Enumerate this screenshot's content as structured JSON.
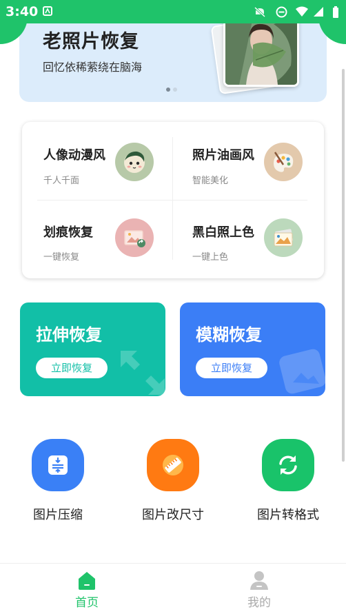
{
  "status_bar": {
    "time": "3:40"
  },
  "banner": {
    "title": "老照片恢复",
    "subtitle": "回忆依稀萦绕在脑海",
    "page_count": 2,
    "active_page": 1
  },
  "features": [
    {
      "title": "人像动漫风",
      "subtitle": "千人千面",
      "icon": "anime-face-icon"
    },
    {
      "title": "照片油画风",
      "subtitle": "智能美化",
      "icon": "paint-palette-icon"
    },
    {
      "title": "划痕恢复",
      "subtitle": "一键恢复",
      "icon": "photo-restore-icon"
    },
    {
      "title": "黑白照上色",
      "subtitle": "一键上色",
      "icon": "colorize-photo-icon"
    }
  ],
  "tiles": [
    {
      "title": "拉伸恢复",
      "button": "立即恢复",
      "color": "#12bfa7"
    },
    {
      "title": "模糊恢复",
      "button": "立即恢复",
      "color": "#3b7ef6"
    }
  ],
  "tools": [
    {
      "label": "图片压缩",
      "icon": "compress-icon"
    },
    {
      "label": "图片改尺寸",
      "icon": "ruler-icon"
    },
    {
      "label": "图片转格式",
      "icon": "convert-icon"
    }
  ],
  "nav": [
    {
      "label": "首页",
      "icon": "home-icon",
      "active": true
    },
    {
      "label": "我的",
      "icon": "profile-icon",
      "active": false
    }
  ],
  "colors": {
    "accent": "#1fc36a",
    "inactive": "#aaaaaa"
  }
}
